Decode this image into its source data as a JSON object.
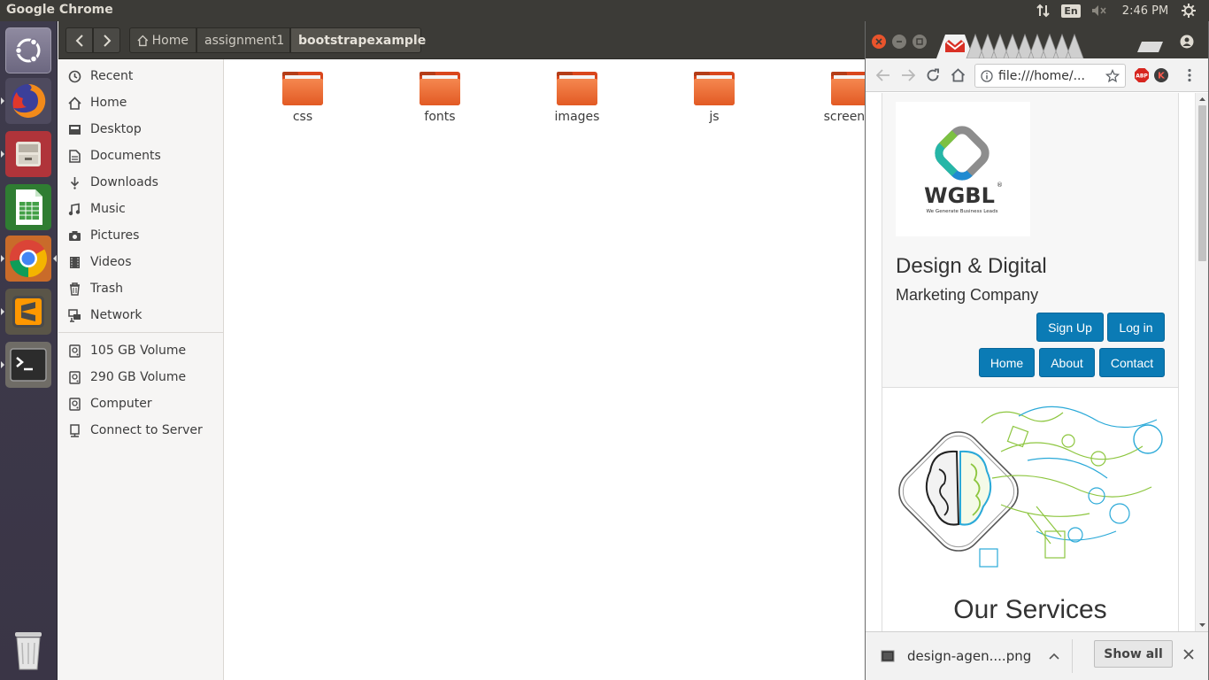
{
  "top_panel": {
    "app_title": "Google Chrome",
    "keyboard_layout": "En",
    "clock": "2:46 PM",
    "icons": [
      "network-arrows-icon",
      "volume-muted-icon",
      "settings-gear-icon"
    ]
  },
  "launcher": {
    "items": [
      "ubuntu-dash",
      "firefox",
      "files",
      "libreoffice-calc",
      "chrome",
      "sublime-text",
      "terminal",
      "trash"
    ]
  },
  "files": {
    "breadcrumbs": [
      "Home",
      "assignment1",
      "bootstrapexample"
    ],
    "sidebar": {
      "places": [
        "Recent",
        "Home",
        "Desktop",
        "Documents",
        "Downloads",
        "Music",
        "Pictures",
        "Videos",
        "Trash",
        "Network"
      ],
      "devices": [
        "105 GB Volume",
        "290 GB Volume",
        "Computer",
        "Connect to Server"
      ]
    },
    "folders": [
      "css",
      "fonts",
      "images",
      "js",
      "screensh"
    ]
  },
  "chrome": {
    "address": "file:///home/...",
    "extension_abp": "ABP",
    "extension_k": "K",
    "site": {
      "logo_text": "WGBL",
      "logo_tagline": "We Generate Business Leads",
      "logo_registered": "®",
      "heading_line1": "Design & Digital",
      "heading_line2": "Marketing Company",
      "signup_label": "Sign Up",
      "login_label": "Log in",
      "nav": [
        "Home",
        "About",
        "Contact"
      ],
      "services_heading": "Our Services"
    },
    "download": {
      "filename": "design-agen....png",
      "show_all_label": "Show all"
    }
  }
}
